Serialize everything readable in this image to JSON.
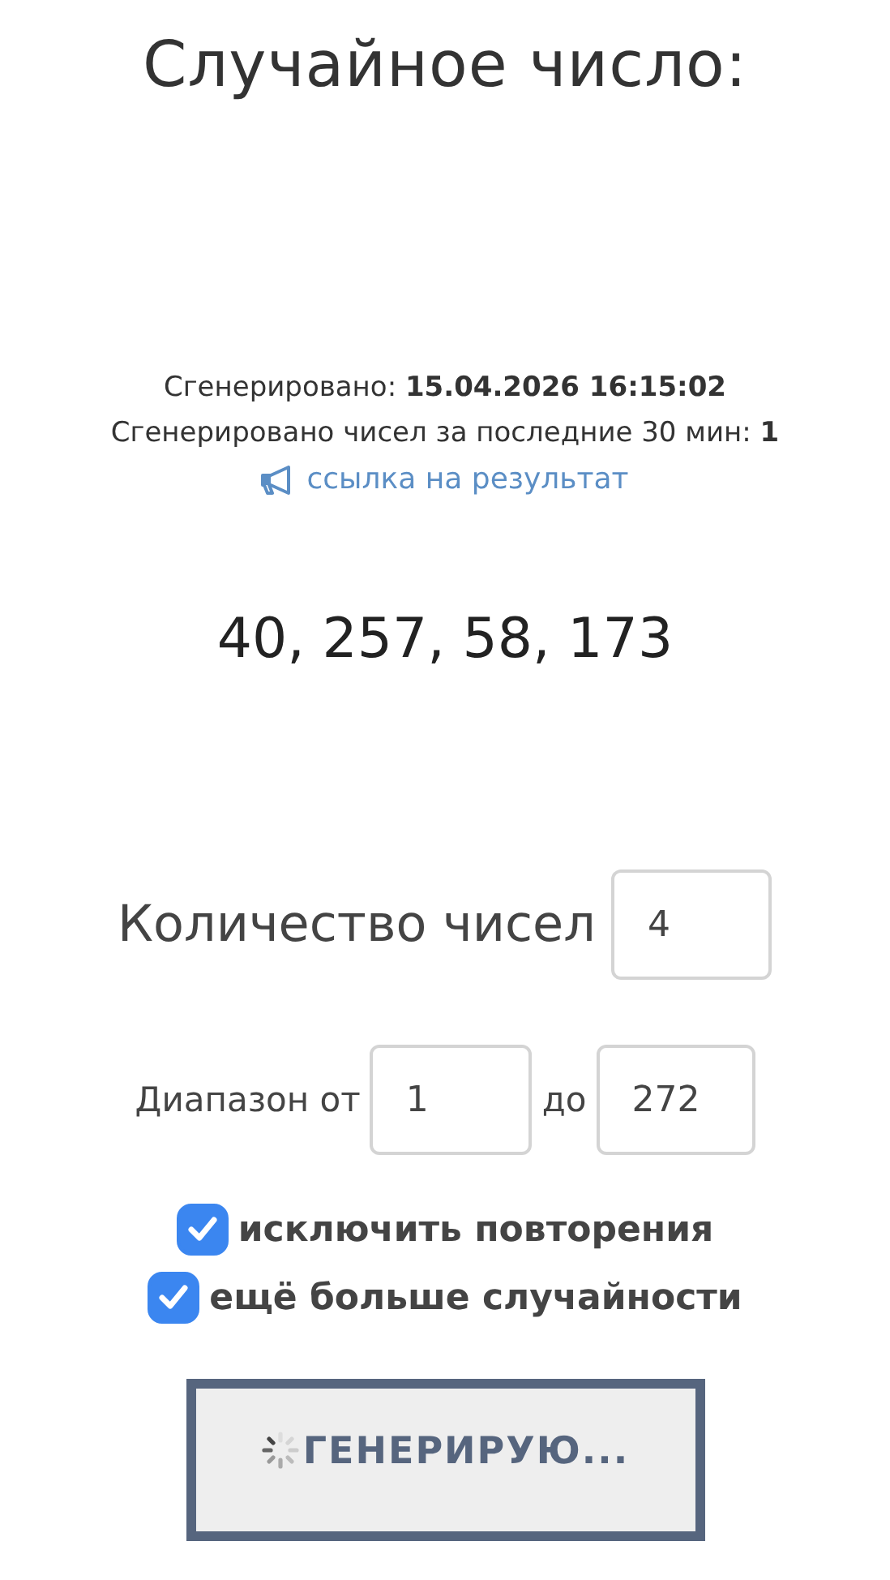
{
  "title": "Случайное число:",
  "info": {
    "generated": "Сгенерировано: **15.04.2026 16:15:02**",
    "count_30min": "Сгенерировано чисел за последние 30 мин: **1**",
    "link": "ссылка на результат"
  },
  "result": "40, 257, 58, 173",
  "count": {
    "label": "Количество чисел",
    "value": "4"
  },
  "range": {
    "label_from": "Диапазон от",
    "from": "1",
    "label_to": "до",
    "to": "272"
  },
  "options": [
    {
      "label": "исключить повторения",
      "checked": true
    },
    {
      "label": "ещё больше случайности",
      "checked": true
    }
  ],
  "button": {
    "label": "ГЕНЕРИРУЮ...",
    "loading": true
  }
}
